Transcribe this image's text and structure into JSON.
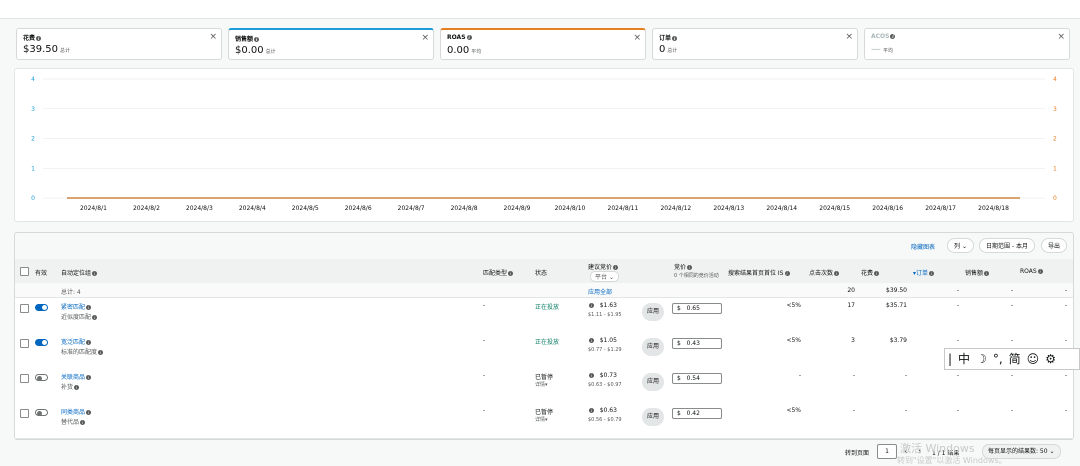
{
  "metrics": [
    {
      "title": "花费",
      "value": "$39.50",
      "sub": "总计",
      "color": "",
      "selected": false,
      "disabled": false
    },
    {
      "title": "销售额",
      "value": "$0.00",
      "sub": "总计",
      "color": "#1b9dd9",
      "selected": true,
      "disabled": false
    },
    {
      "title": "ROAS",
      "value": "0.00",
      "sub": "平均",
      "color": "#e67e22",
      "selected": true,
      "disabled": false
    },
    {
      "title": "订单",
      "value": "0",
      "sub": "总计",
      "color": "",
      "selected": false,
      "disabled": false
    },
    {
      "title": "ACOS",
      "value": "—",
      "sub": "平均",
      "color": "",
      "selected": false,
      "disabled": true
    }
  ],
  "close_glyph": "×",
  "chart_data": {
    "type": "line",
    "x": [
      "2024/8/1",
      "2024/8/2",
      "2024/8/3",
      "2024/8/4",
      "2024/8/5",
      "2024/8/6",
      "2024/8/7",
      "2024/8/8",
      "2024/8/9",
      "2024/8/10",
      "2024/8/11",
      "2024/8/12",
      "2024/8/13",
      "2024/8/14",
      "2024/8/15",
      "2024/8/16",
      "2024/8/17",
      "2024/8/18"
    ],
    "yticks_left": [
      0,
      1,
      2,
      3,
      4
    ],
    "yticks_right": [
      0,
      1,
      2,
      3,
      4
    ],
    "ylim": [
      0,
      4
    ],
    "series": [
      {
        "values": [
          0,
          0,
          0,
          0,
          0,
          0,
          0,
          0,
          0,
          0,
          0,
          0,
          0,
          0,
          0,
          0,
          0,
          0
        ],
        "color": "#1b9dd9"
      },
      {
        "values": [
          0,
          0,
          0,
          0,
          0,
          0,
          0,
          0,
          0,
          0,
          0,
          0,
          0,
          0,
          0,
          0,
          0,
          0
        ],
        "color": "#e67e22"
      }
    ],
    "left_axis_color": "#1b9dd9",
    "right_axis_color": "#e67e22",
    "grid": true
  },
  "toolbar": {
    "hide_chart": "隐藏图表",
    "columns": "列",
    "date_range": "日期范围 - 本月",
    "export": "导出",
    "chevron": "⌄"
  },
  "headers": {
    "active": "有效",
    "group": "自动定位组",
    "match": "匹配类型",
    "status": "状态",
    "suggested": "建议竞价",
    "suggested_sel": "平台",
    "bid": "竞价",
    "bid_note": "0 个相同的竞价活动",
    "top_is": "搜索结果首页首位 IS",
    "clicks": "点击次数",
    "spend": "花费",
    "orders": "订单",
    "sales": "销售额",
    "roas": "ROAS"
  },
  "summary": {
    "label": "总计: 4",
    "apply_all": "应用全部",
    "clicks": "20",
    "spend": "$39.50",
    "orders": "-",
    "sales": "-",
    "roas": "-"
  },
  "rows": [
    {
      "name": "紧密匹配",
      "sub": "近似度匹配",
      "on": true,
      "match": "-",
      "status": "正在投放",
      "status_green": true,
      "status_sub": "",
      "suggested": "$1.63",
      "range": "$1.11 - $1.95",
      "apply": "应用",
      "currency": "$",
      "bid": "0.65",
      "top_is": "<5%",
      "clicks": "17",
      "spend": "$35.71",
      "orders": "-",
      "sales": "-",
      "roas": "-"
    },
    {
      "name": "宽泛匹配",
      "sub": "标准的匹配度",
      "on": true,
      "match": "-",
      "status": "正在投放",
      "status_green": true,
      "status_sub": "",
      "suggested": "$1.05",
      "range": "$0.77 - $1.29",
      "apply": "应用",
      "currency": "$",
      "bid": "0.43",
      "top_is": "<5%",
      "clicks": "3",
      "spend": "$3.79",
      "orders": "-",
      "sales": "-",
      "roas": "-"
    },
    {
      "name": "关联商品",
      "sub": "补货",
      "on": false,
      "match": "-",
      "status": "已暂停",
      "status_green": false,
      "status_sub": "详情",
      "suggested": "$0.73",
      "range": "$0.63 - $0.97",
      "apply": "应用",
      "currency": "$",
      "bid": "0.54",
      "top_is": "-",
      "clicks": "-",
      "spend": "-",
      "orders": "-",
      "sales": "-",
      "roas": "-"
    },
    {
      "name": "同类商品",
      "sub": "替代品",
      "on": false,
      "match": "-",
      "status": "已暂停",
      "status_green": false,
      "status_sub": "详情",
      "suggested": "$0.63",
      "range": "$0.56 - $0.79",
      "apply": "应用",
      "currency": "$",
      "bid": "0.42",
      "top_is": "<5%",
      "clicks": "-",
      "spend": "-",
      "orders": "-",
      "sales": "-",
      "roas": "-"
    }
  ],
  "footer": {
    "goto": "转到页面",
    "page": "1",
    "prev": "‹",
    "next": "›",
    "page_of": "1 / 1 结果",
    "per_page": "每页显示的结果数: 50"
  },
  "ime": [
    "|",
    "中",
    "☽",
    "°,",
    "简",
    "☺",
    "⚙"
  ],
  "watermark": {
    "line1": "激活 Windows",
    "line2": "转到\"设置\"以激活 Windows。"
  }
}
